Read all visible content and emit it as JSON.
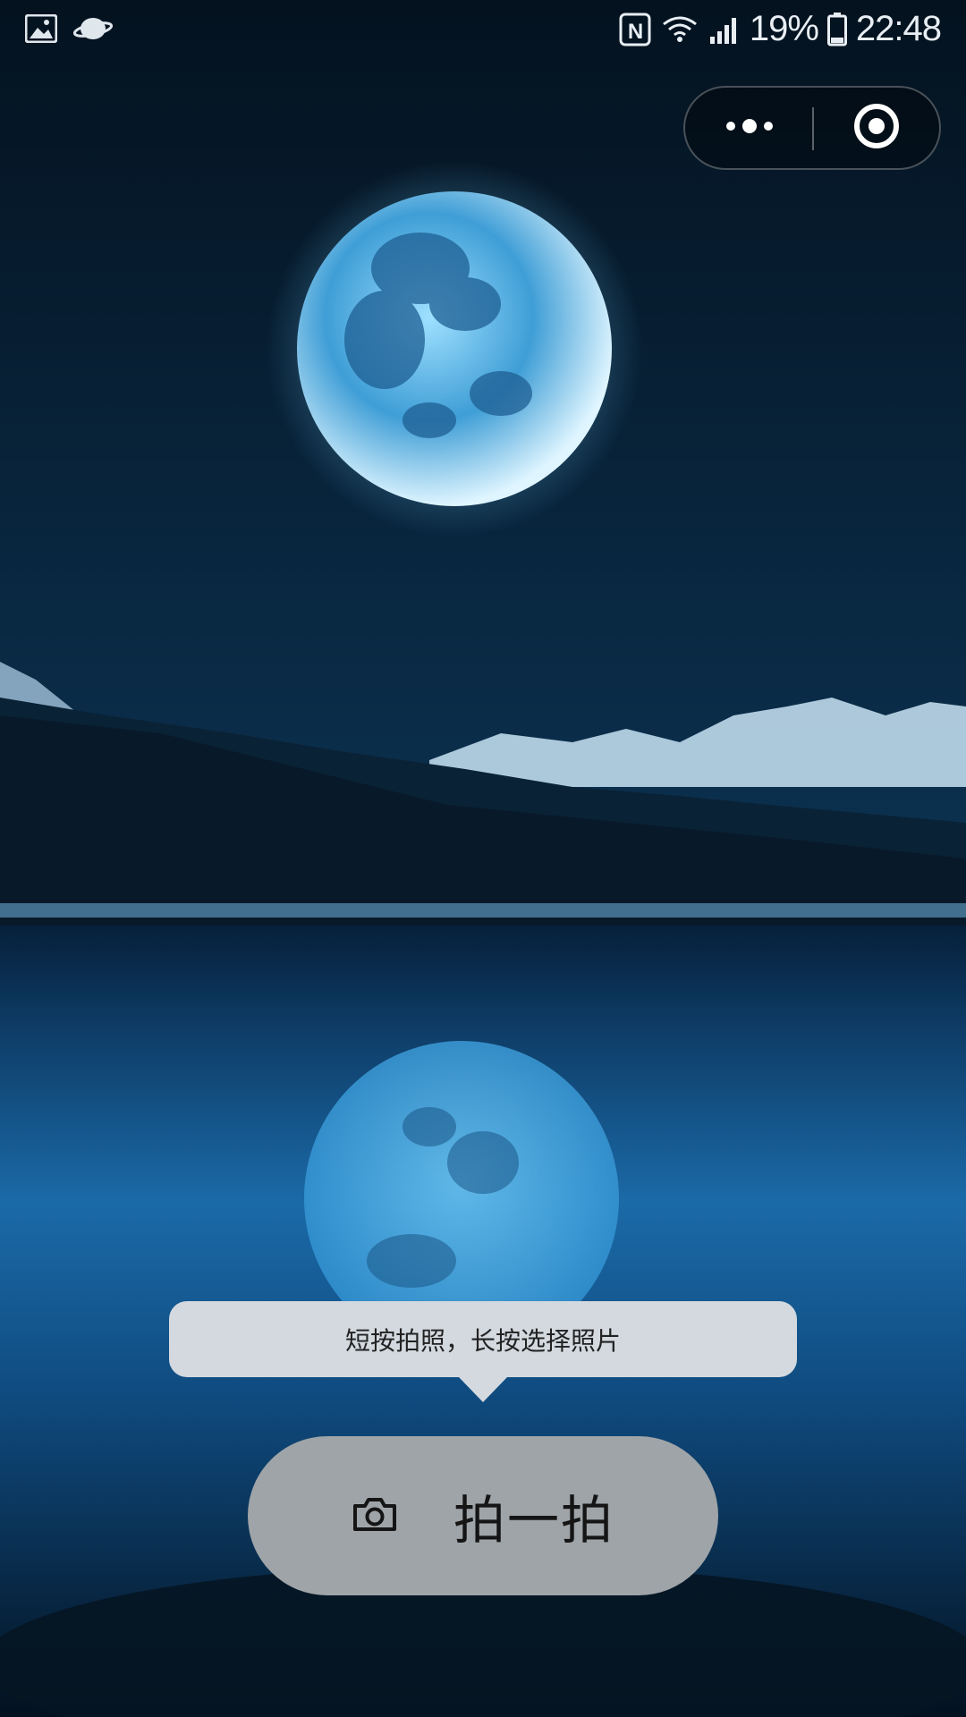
{
  "status_bar": {
    "left_icons": [
      "gallery-icon",
      "planet-icon"
    ],
    "right_icons": [
      "nfc-icon",
      "wifi-icon",
      "signal-icon",
      "battery-icon"
    ],
    "battery_percent": "19%",
    "time": "22:48"
  },
  "capsule": {
    "more_icon": "more-dots-icon",
    "close_icon": "target-close-icon"
  },
  "tooltip": {
    "text": "短按拍照，长按选择照片"
  },
  "shoot_button": {
    "icon": "camera-icon",
    "label": "拍一拍"
  },
  "colors": {
    "sky_top": "#061a2e",
    "moon": "#6fc4f0",
    "water": "#1d74b8",
    "tooltip_bg": "#d3d9df",
    "button_bg": "#9fa4a8"
  }
}
